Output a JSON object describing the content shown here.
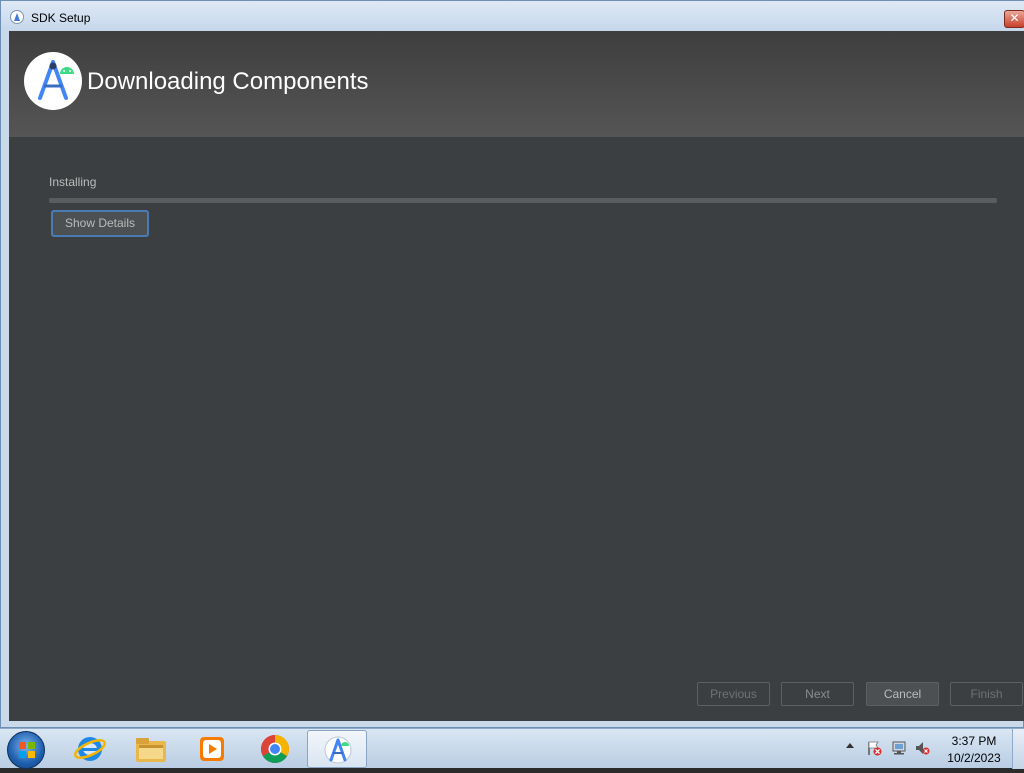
{
  "window": {
    "title": "SDK Setup",
    "close_label": "✕"
  },
  "header": {
    "title": "Downloading Components",
    "logo_icon": "android-studio-icon"
  },
  "main": {
    "status_label": "Installing",
    "progress_fraction": 0.0,
    "show_details_label": "Show Details"
  },
  "footer": {
    "previous_label": "Previous",
    "next_label": "Next",
    "cancel_label": "Cancel",
    "finish_label": "Finish"
  },
  "taskbar": {
    "apps": [
      "start-button",
      "internet-explorer-icon",
      "file-explorer-icon",
      "media-player-icon",
      "chrome-icon",
      "android-studio-icon"
    ],
    "clock_time": "3:37 PM",
    "clock_date": "10/2/2023"
  },
  "colors": {
    "header_bg": "#4a4a4a",
    "body_bg": "#3c3f41",
    "focus_border": "#4a7bb5",
    "text": "#bbbbbb"
  }
}
